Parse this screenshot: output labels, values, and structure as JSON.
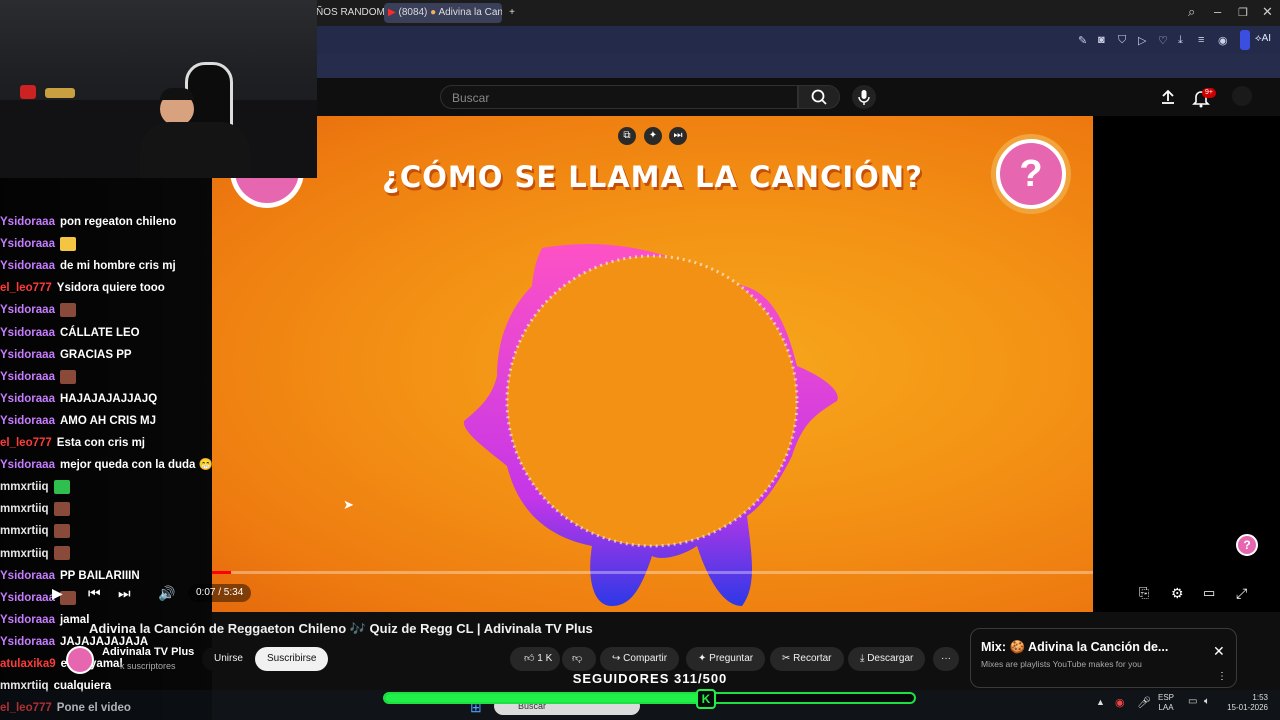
{
  "browser": {
    "tabs": [
      {
        "label": "ÑOS RANDOM"
      },
      {
        "label": "(8084)"
      },
      {
        "label": "Adivina la Canci"
      }
    ],
    "new_tab_icon": "plus-icon",
    "ai_label": "AI"
  },
  "youtube": {
    "search_placeholder": "Buscar",
    "notifications_count": "9+"
  },
  "video": {
    "title_overlay": "¿CÓMO SE LLAMA LA CANCIÓN?",
    "question_mark": "?",
    "time": "0:07 / 5:34",
    "progress_fraction": 0.021
  },
  "webcam": {
    "description_none": ""
  },
  "chat": {
    "messages": [
      {
        "user": "Ysidoraaa",
        "user_color": "#c77dff",
        "text": "pon regeaton chileno"
      },
      {
        "user": "Ysidoraaa",
        "user_color": "#c77dff",
        "text": "",
        "emote": "#f4c542"
      },
      {
        "user": "Ysidoraaa",
        "user_color": "#c77dff",
        "text": "de mi hombre cris mj"
      },
      {
        "user": "el_leo777",
        "user_color": "#ff3b3b",
        "text": "Ysidora quiere tooo"
      },
      {
        "user": "Ysidoraaa",
        "user_color": "#c77dff",
        "text": "",
        "emote": "#8a4a3a"
      },
      {
        "user": "Ysidoraaa",
        "user_color": "#c77dff",
        "text": "CÁLLATE LEO"
      },
      {
        "user": "Ysidoraaa",
        "user_color": "#c77dff",
        "text": "GRACIAS PP"
      },
      {
        "user": "Ysidoraaa",
        "user_color": "#c77dff",
        "text": "",
        "emote": "#8a4a3a"
      },
      {
        "user": "Ysidoraaa",
        "user_color": "#c77dff",
        "text": "HAJAJAJAJJAJQ"
      },
      {
        "user": "Ysidoraaa",
        "user_color": "#c77dff",
        "text": "AMO AH CRIS MJ"
      },
      {
        "user": "el_leo777",
        "user_color": "#ff3b3b",
        "text": "Esta con cris mj"
      },
      {
        "user": "Ysidoraaa",
        "user_color": "#c77dff",
        "text": "mejor queda con la duda 😁"
      },
      {
        "user": "mmxrtiiq",
        "user_color": "#e6e6e6",
        "text": "",
        "emote": "#2fbf4f"
      },
      {
        "user": "mmxrtiiq",
        "user_color": "#e6e6e6",
        "text": "",
        "emote": "#8a4a3a"
      },
      {
        "user": "mmxrtiiq",
        "user_color": "#e6e6e6",
        "text": "",
        "emote": "#8a4a3a"
      },
      {
        "user": "mmxrtiiq",
        "user_color": "#e6e6e6",
        "text": "",
        "emote": "#8a4a3a"
      },
      {
        "user": "Ysidoraaa",
        "user_color": "#c77dff",
        "text": "PP BAILARIIIN"
      },
      {
        "user": "Ysidoraaa",
        "user_color": "#c77dff",
        "text": "",
        "emote": "#8a4a3a"
      },
      {
        "user": "Ysidoraaa",
        "user_color": "#c77dff",
        "text": "jamal"
      },
      {
        "user": "Ysidoraaa",
        "user_color": "#c77dff",
        "text": "JAJAJAJAJAJA"
      },
      {
        "user": "atulaxika9",
        "user_color": "#ff3b3b",
        "text": "el de yamal"
      },
      {
        "user": "mmxrtiiq",
        "user_color": "#e6e6e6",
        "text": "cualquiera"
      },
      {
        "user": "el_leo777",
        "user_color": "#ff3b3b",
        "text": "Pone el video"
      }
    ]
  },
  "watch": {
    "title": "Adivina la Canción de Reggaeton Chileno 🎶 Quiz de Regg CL | Adivinala TV Plus",
    "channel": "Adivinala TV Plus",
    "subscribers": "k suscriptores",
    "join_label": "Unirse",
    "subscribe_label": "Suscribirse",
    "like_count": "1 K",
    "share_label": "Compartir",
    "ask_label": "Preguntar",
    "clip_label": "Recortar",
    "download_label": "Descargar"
  },
  "mix": {
    "title": "Mix: 🍪 Adivina la Canción de...",
    "subtitle": "Mixes are playlists YouTube makes for you"
  },
  "overlay": {
    "followers_text": "SEGUIDORES 311/500",
    "followers_current": 311,
    "followers_goal": 500,
    "kick_letter": "K"
  },
  "taskbar": {
    "search_label": "Buscar",
    "lang_top": "ESP",
    "lang_bottom": "LAA",
    "time": "1:53",
    "date": "15-01-2026"
  },
  "colors": {
    "accent_green": "#22f04a",
    "youtube_red": "#ff0000",
    "quiz_pink": "#e667b0",
    "video_orange": "#f39114"
  }
}
